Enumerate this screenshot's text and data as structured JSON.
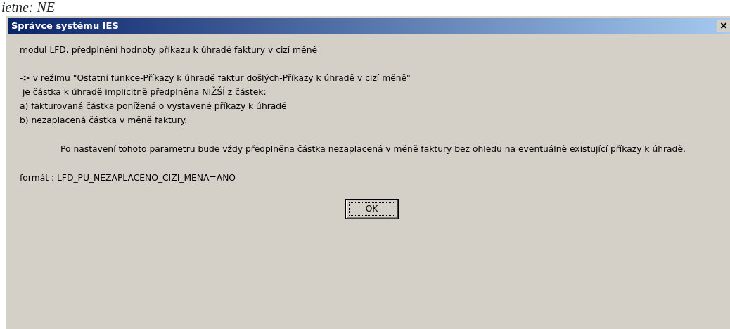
{
  "page_fragment": "ietne: NE",
  "dialog": {
    "title": "Správce systému IES",
    "close_label": "×",
    "paragraphs": [
      {
        "kind": "lines",
        "lines": [
          "modul LFD, předplnění hodnoty příkazu k úhradě faktury v cizí měně"
        ]
      },
      {
        "kind": "lines",
        "lines": [
          "-> v režimu \"Ostatní funkce-Příkazy k úhradě faktur došlých-Příkazy k úhradě v cizí měně\"",
          " je částka k úhradě implicitně předplněna NIŽŠÍ z částek:",
          "a) fakturovaná částka ponížená o vystavené příkazy k úhradě",
          "b) nezaplacená částka v měně faktury."
        ]
      },
      {
        "kind": "indented",
        "text": "Po nastavení tohoto parametru bude vždy předplněna částka nezaplacená v měně faktury bez ohledu na eventuálně existující příkazy k úhradě."
      },
      {
        "kind": "lines",
        "lines": [
          "formát : LFD_PU_NEZAPLACENO_CIZI_MENA=ANO"
        ]
      }
    ],
    "buttons": [
      {
        "label": "OK",
        "focused": true
      }
    ]
  }
}
